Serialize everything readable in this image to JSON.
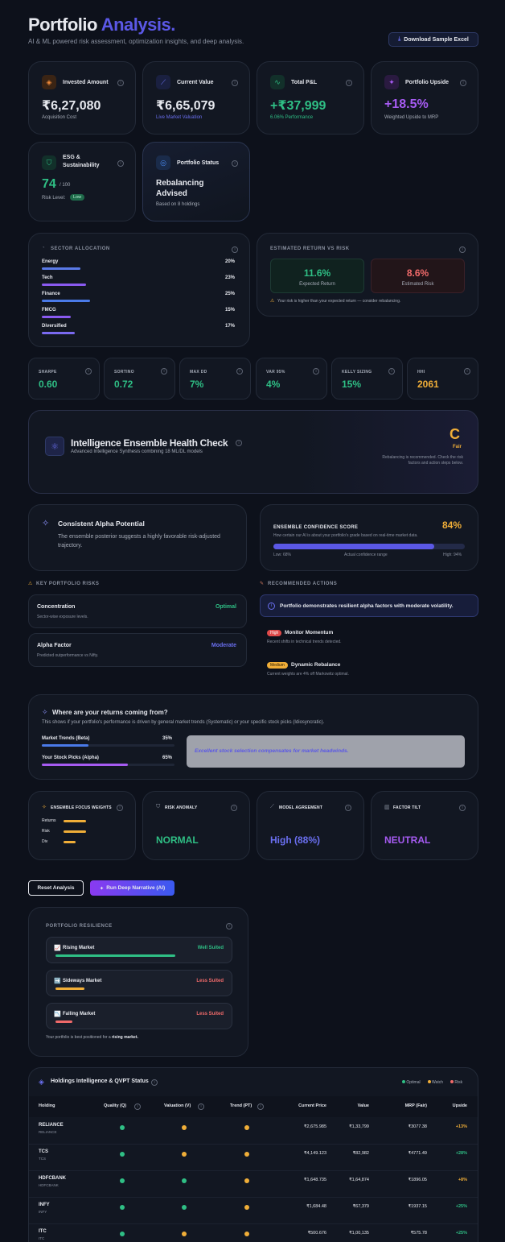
{
  "header": {
    "title_main": "Portfolio",
    "title_accent": "Analysis.",
    "subtitle": "AI & ML powered risk assessment, optimization insights, and deep analysis.",
    "download_label": "Download Sample Excel"
  },
  "kpis": {
    "invested": {
      "label": "Invested Amount",
      "value": "₹6,27,080",
      "sub": "Acquisition Cost"
    },
    "current": {
      "label": "Current Value",
      "value": "₹6,65,079",
      "sub": "Live Market Valuation"
    },
    "pnl": {
      "label": "Total P&L",
      "value": "+₹37,999",
      "sub": "6.06% Performance"
    },
    "upside": {
      "label": "Portfolio Upside",
      "value": "+18.5%",
      "sub": "Weighted Upside to MRP"
    },
    "esg": {
      "label": "ESG & Sustainability",
      "value": "74",
      "unit": "/ 100",
      "risk_label": "Risk Level:",
      "risk_badge": "Low"
    },
    "status": {
      "label": "Portfolio Status",
      "value": "Rebalancing Advised",
      "sub": "Based on 8 holdings"
    }
  },
  "sector": {
    "title": "SECTOR ALLOCATION",
    "items": [
      {
        "name": "Energy",
        "pct": "20%",
        "value": 20
      },
      {
        "name": "Tech",
        "pct": "23%",
        "value": 23
      },
      {
        "name": "Finance",
        "pct": "25%",
        "value": 25
      },
      {
        "name": "FMCG",
        "pct": "15%",
        "value": 15
      },
      {
        "name": "Diversified",
        "pct": "17%",
        "value": 17
      }
    ]
  },
  "returnrisk": {
    "title": "ESTIMATED RETURN VS RISK",
    "expected_value": "11.6%",
    "expected_label": "Expected Return",
    "risk_value": "8.6%",
    "risk_label": "Estimated Risk",
    "warning": "Your risk is higher than your expected return — consider rebalancing."
  },
  "metrics": [
    {
      "label": "SHARPE",
      "value": "0.60"
    },
    {
      "label": "SORTINO",
      "value": "0.72"
    },
    {
      "label": "MAX DD",
      "value": "7%"
    },
    {
      "label": "VAR 95%",
      "value": "4%"
    },
    {
      "label": "KELLY SIZING",
      "value": "15%"
    },
    {
      "label": "HHI",
      "value": "2061"
    }
  ],
  "health": {
    "title": "Intelligence Ensemble Health Check",
    "subtitle": "Advanced Intelligence Synthesis combining 18 ML/DL models",
    "grade": "C",
    "grade_label": "Fair",
    "note": "Rebalancing is recommended. Check the risk factors and action steps below."
  },
  "alpha": {
    "title": "Consistent Alpha Potential",
    "desc": "The ensemble posterior suggests a highly favorable risk-adjusted trajectory."
  },
  "confidence": {
    "title": "ENSEMBLE CONFIDENCE SCORE",
    "score": "84%",
    "desc": "How certain our AI is about your portfolio's grade based on real-time market data.",
    "low": "Low: 68%",
    "mid": "Actual confidence range",
    "high": "High: 94%",
    "fill": 0.84
  },
  "risks": {
    "title": "KEY PORTFOLIO RISKS",
    "items": [
      {
        "name": "Concentration",
        "desc": "Sector-wise exposure levels.",
        "status": "Optimal"
      },
      {
        "name": "Alpha Factor",
        "desc": "Predicted outperformance vs Nifty.",
        "status": "Moderate"
      }
    ]
  },
  "actions": {
    "title": "RECOMMENDED ACTIONS",
    "banner": "Portfolio demonstrates resilient alpha factors with moderate volatility.",
    "items": [
      {
        "badge": "High",
        "name": "Monitor Momentum",
        "desc": "Recent shifts in technical trends detected."
      },
      {
        "badge": "Medium",
        "name": "Dynamic Rebalance",
        "desc": "Current weights are 4% off Markowitz optimal."
      }
    ]
  },
  "returns": {
    "title": "Where are your returns coming from?",
    "desc": "This shows if your portfolio's performance is driven by general market trends (Systematic) or your specific stock picks (Idiosyncratic).",
    "beta_label": "Market Trends (Beta)",
    "beta_pct": "35%",
    "beta": 35,
    "alpha_label": "Your Stock Picks (Alpha)",
    "alpha_pct": "65%",
    "alpha": 65,
    "callout": "Excellent stock selection compensates for market headwinds."
  },
  "ensemble": {
    "title": "ENSEMBLE FOCUS WEIGHTS",
    "items": [
      {
        "name": "Returns",
        "value": 0.85
      },
      {
        "name": "Risk",
        "value": 0.85
      },
      {
        "name": "Div",
        "value": 0.45
      }
    ]
  },
  "anomaly": {
    "title": "RISK ANOMALY",
    "value": "NORMAL"
  },
  "agreement": {
    "title": "MODEL AGREEMENT",
    "value": "High (88%)"
  },
  "tilt": {
    "title": "FACTOR TILT",
    "value": "NEUTRAL"
  },
  "buttons": {
    "reset": "Reset Analysis",
    "run": "Run Deep Narrative (AI)"
  },
  "resilience": {
    "title": "PORTFOLIO RESILIENCE",
    "items": [
      {
        "icon": "📈",
        "name": "Rising Market",
        "status": "Well Suited",
        "fill": 0.98
      },
      {
        "icon": "➡️",
        "name": "Sideways Market",
        "status": "Less Suited",
        "fill": 0.24
      },
      {
        "icon": "📉",
        "name": "Falling Market",
        "status": "Less Suited",
        "fill": 0.14
      }
    ],
    "footer_pre": "Your portfolio is best positioned for a",
    "footer_bold": "rising market."
  },
  "holdings": {
    "title": "Holdings Intelligence & QVPT Status",
    "legend": [
      "Optimal",
      "Watch",
      "Risk"
    ],
    "columns": [
      "Holding",
      "Quality (Q)",
      "Valuation (V)",
      "Trend (PT)",
      "Current Price",
      "Value",
      "MRP (Fair)",
      "Upside"
    ],
    "rows": [
      {
        "sym": "RELIANCE",
        "sub": "RELIANCE",
        "q": "green",
        "v": "orange",
        "t": "orange",
        "price": "₹2,675.985",
        "value": "₹1,33,799",
        "mrp": "₹3077.38",
        "up": "+13%",
        "upc": "orange"
      },
      {
        "sym": "TCS",
        "sub": "TCS",
        "q": "green",
        "v": "orange",
        "t": "orange",
        "price": "₹4,149.123",
        "value": "₹82,982",
        "mrp": "₹4771.49",
        "up": "+28%",
        "upc": "green"
      },
      {
        "sym": "HDFCBANK",
        "sub": "HDFCBANK",
        "q": "green",
        "v": "green",
        "t": "orange",
        "price": "₹1,648.735",
        "value": "₹1,64,874",
        "mrp": "₹1896.05",
        "up": "+8%",
        "upc": "orange"
      },
      {
        "sym": "INFY",
        "sub": "INFY",
        "q": "green",
        "v": "green",
        "t": "orange",
        "price": "₹1,684.48",
        "value": "₹67,379",
        "mrp": "₹1937.15",
        "up": "+25%",
        "upc": "green"
      },
      {
        "sym": "ITC",
        "sub": "ITC",
        "q": "green",
        "v": "orange",
        "t": "orange",
        "price": "₹500.676",
        "value": "₹1,00,135",
        "mrp": "₹575.78",
        "up": "+25%",
        "upc": "green"
      }
    ]
  }
}
